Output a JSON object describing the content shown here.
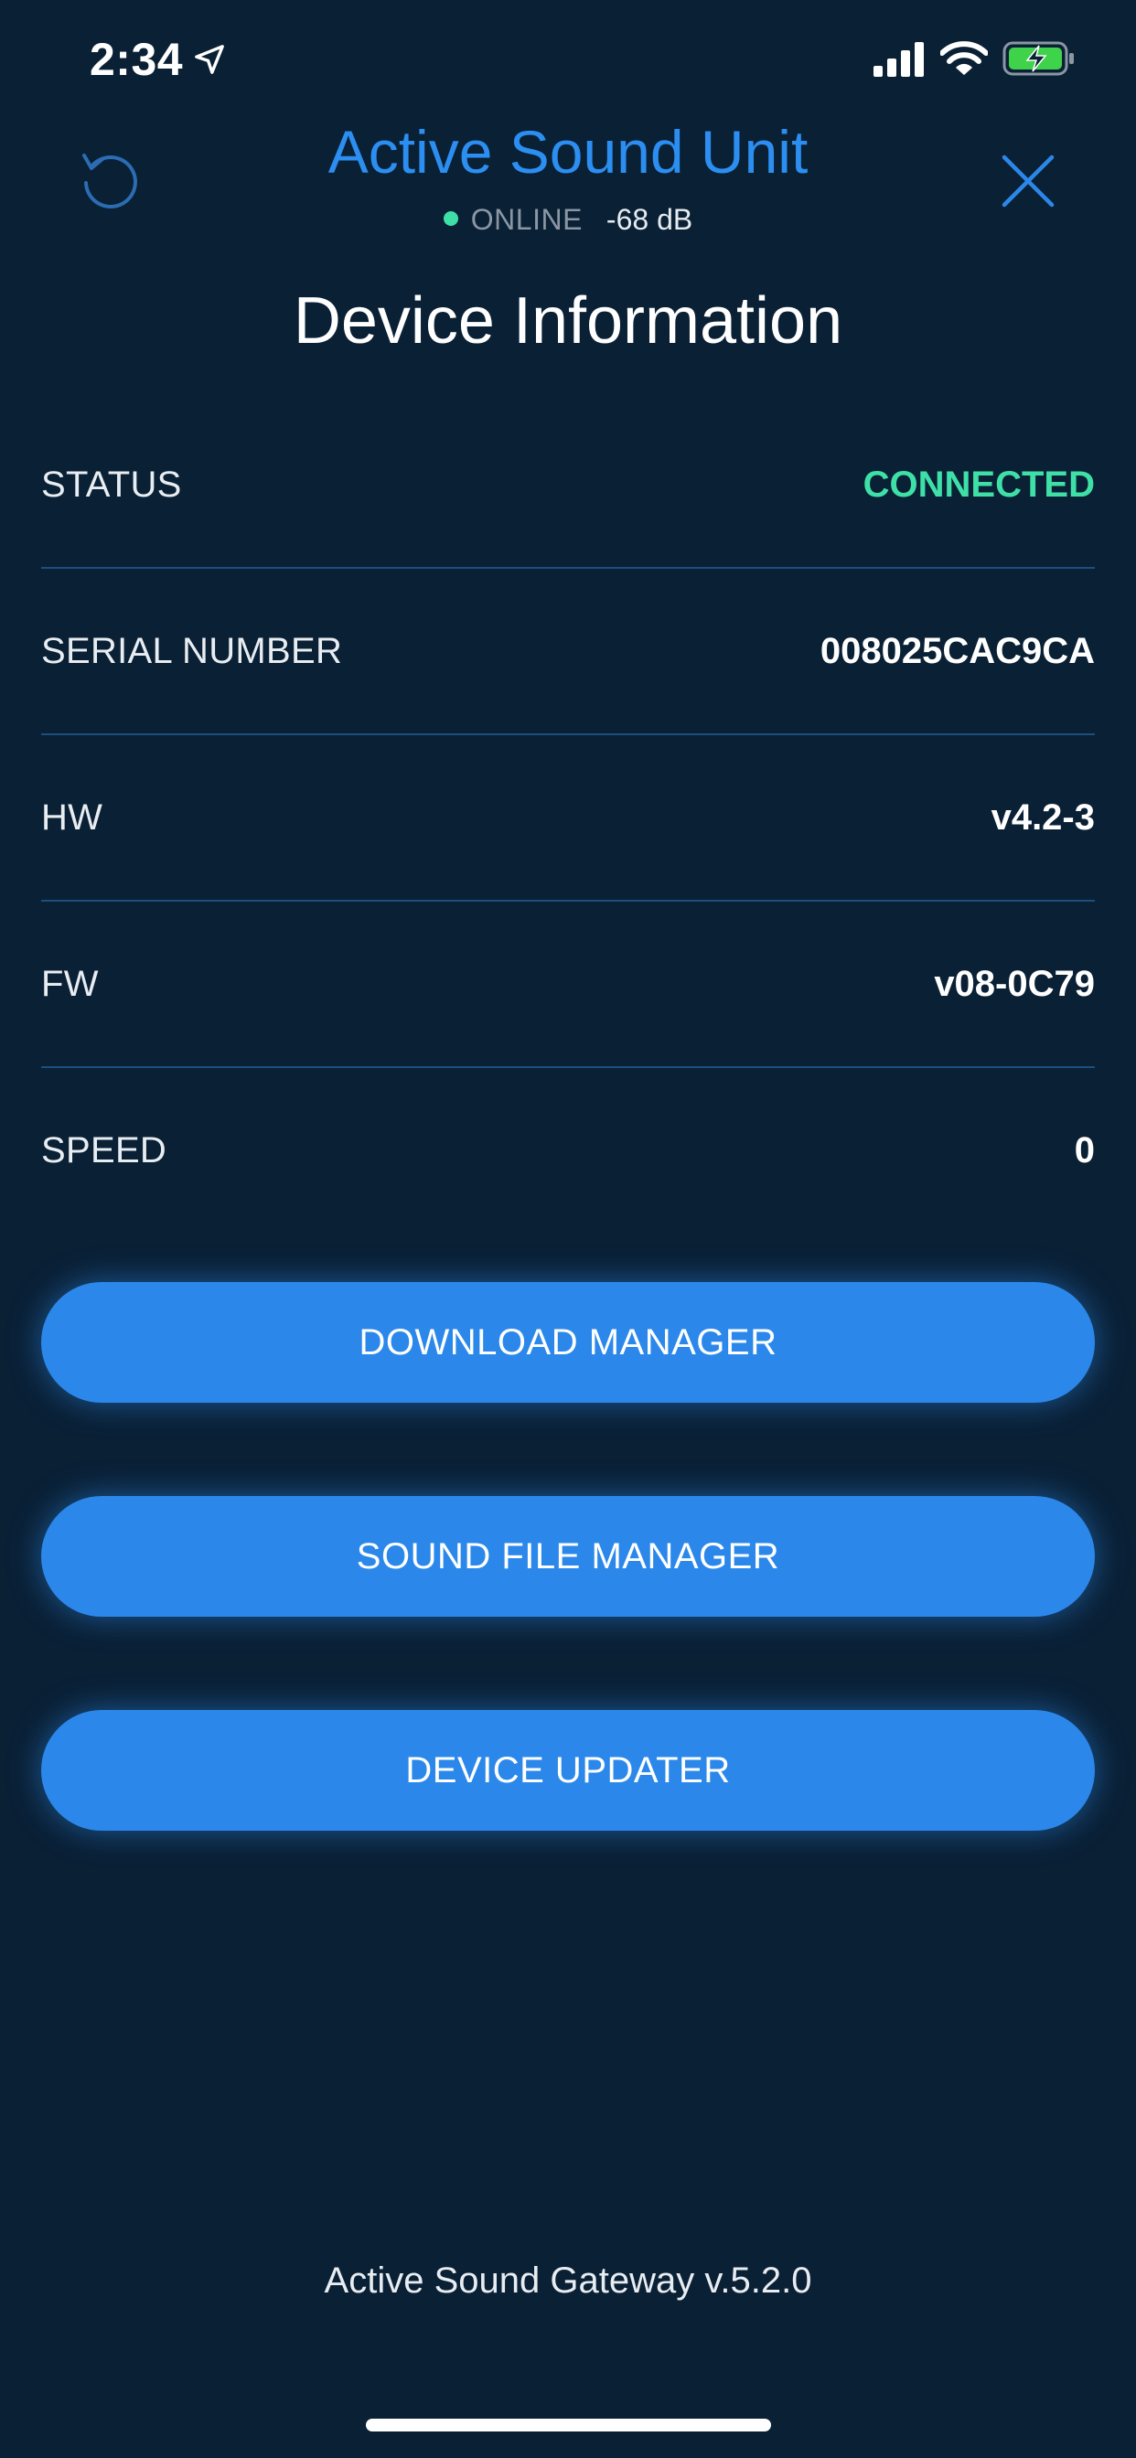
{
  "status_bar": {
    "time": "2:34",
    "icons": [
      "location-arrow-icon",
      "cellular-signal-icon",
      "wifi-icon",
      "battery-charging-icon"
    ]
  },
  "header": {
    "title": "Active Sound Unit",
    "connection_status": "ONLINE",
    "signal_strength": "-68 dB",
    "left_icon": "refresh-icon",
    "right_icon": "close-icon"
  },
  "page_title": "Device Information",
  "info_rows": [
    {
      "label": "STATUS",
      "value": "CONNECTED"
    },
    {
      "label": "SERIAL NUMBER",
      "value": "008025CAC9CA"
    },
    {
      "label": "HW",
      "value": "v4.2-3"
    },
    {
      "label": "FW",
      "value": "v08-0C79"
    },
    {
      "label": "SPEED",
      "value": "0"
    }
  ],
  "buttons": {
    "download_manager": "DOWNLOAD MANAGER",
    "sound_file_manager": "SOUND FILE MANAGER",
    "device_updater": "DEVICE UPDATER"
  },
  "footer": "Active Sound Gateway v.5.2.0",
  "colors": {
    "background": "#0a2035",
    "accent": "#2b88ea",
    "title_blue": "#2b8ef0",
    "online_green": "#3ee0a8",
    "divider": "#1d4f7d"
  }
}
